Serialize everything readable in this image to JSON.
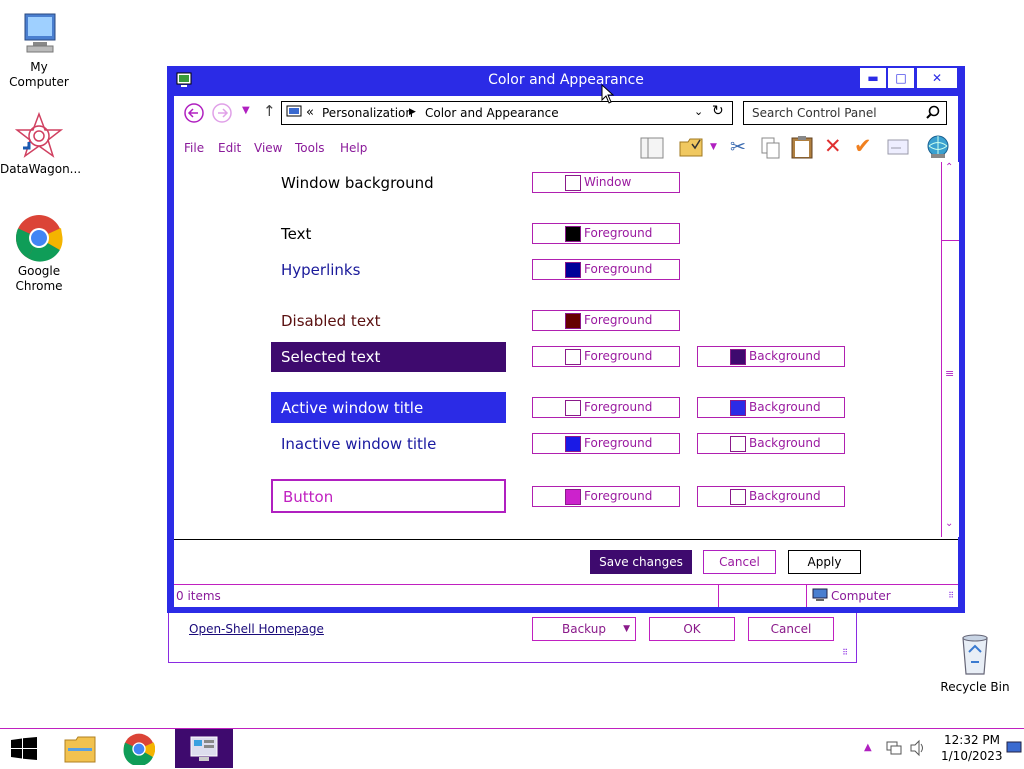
{
  "desktop": {
    "icons": [
      {
        "label": "My Computer",
        "icon": "computer-icon"
      },
      {
        "label": "DataWagon...",
        "icon": "datawagon-icon"
      },
      {
        "label": "Google Chrome",
        "icon": "chrome-icon"
      },
      {
        "label": "Recycle Bin",
        "icon": "recycle-bin-icon"
      }
    ]
  },
  "bg_dialog": {
    "link": "Open-Shell Homepage",
    "backup_label": "Backup",
    "ok_label": "OK",
    "cancel_label": "Cancel"
  },
  "window": {
    "title": "Color and Appearance",
    "breadcrumb_prefix": "«",
    "breadcrumb": [
      "Personalization",
      "Color and Appearance"
    ],
    "search_placeholder": "Search Control Panel",
    "menu": [
      "File",
      "Edit",
      "View",
      "Tools",
      "Help"
    ],
    "rows": {
      "window_background": {
        "label": "Window background",
        "btn1": "Window",
        "c1": "#ffffff"
      },
      "text": {
        "label": "Text",
        "btn1": "Foreground",
        "c1": "#000000"
      },
      "hyperlinks": {
        "label": "Hyperlinks",
        "btn1": "Foreground",
        "c1": "#000099"
      },
      "disabled_text": {
        "label": "Disabled text",
        "btn1": "Foreground",
        "c1": "#660000"
      },
      "selected_text": {
        "label": "Selected text",
        "btn1": "Foreground",
        "btn2": "Background",
        "c1": "#ffffff",
        "c2": "#3e0a6e"
      },
      "active_title": {
        "label": "Active window title",
        "btn1": "Foreground",
        "btn2": "Background",
        "c1": "#ffffff",
        "c2": "#2b2be6"
      },
      "inactive_title": {
        "label": "Inactive window title",
        "btn1": "Foreground",
        "btn2": "Background",
        "c1": "#1a1ae6",
        "c2": "#ffffff"
      },
      "button": {
        "label": "Button",
        "btn1": "Foreground",
        "btn2": "Background",
        "c1": "#cc22cc",
        "c2": "#ffffff"
      }
    },
    "save_label": "Save changes",
    "cancel_label": "Cancel",
    "apply_label": "Apply",
    "status_items": "0 items",
    "status_location": "Computer"
  },
  "taskbar": {
    "time": "12:32 PM",
    "date": "1/10/2023"
  },
  "colors": {
    "accent": "#2b2be6",
    "selected_bg": "#3e0a6e",
    "border_magenta": "#c020c0"
  }
}
